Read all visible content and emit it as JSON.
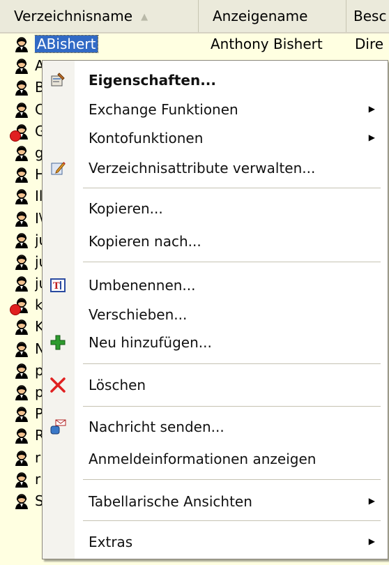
{
  "columns": {
    "name": "Verzeichnisname",
    "display": "Anzeigename",
    "third": "Besc"
  },
  "rows": [
    {
      "name": "ABishert",
      "display": "Anthony Bishert",
      "third": "Dire",
      "selected": true,
      "disabled": false
    },
    {
      "name": "A",
      "display": "",
      "third": "",
      "selected": false,
      "disabled": false
    },
    {
      "name": "B",
      "display": "",
      "third": "",
      "selected": false,
      "disabled": false
    },
    {
      "name": "C",
      "display": "",
      "third": "",
      "selected": false,
      "disabled": false
    },
    {
      "name": "G",
      "display": "",
      "third": "",
      "selected": false,
      "disabled": true
    },
    {
      "name": "g",
      "display": "",
      "third": "",
      "selected": false,
      "disabled": false
    },
    {
      "name": "H",
      "display": "",
      "third": "",
      "selected": false,
      "disabled": false
    },
    {
      "name": "Il",
      "display": "",
      "third": "",
      "selected": false,
      "disabled": false
    },
    {
      "name": "I\\",
      "display": "",
      "third": "",
      "selected": false,
      "disabled": false
    },
    {
      "name": "ju",
      "display": "",
      "third": "",
      "selected": false,
      "disabled": false
    },
    {
      "name": "ju",
      "display": "",
      "third": "",
      "selected": false,
      "disabled": false
    },
    {
      "name": "ju",
      "display": "",
      "third": "",
      "selected": false,
      "disabled": false
    },
    {
      "name": "k",
      "display": "",
      "third": "",
      "selected": false,
      "disabled": true
    },
    {
      "name": "K",
      "display": "",
      "third": "",
      "selected": false,
      "disabled": false
    },
    {
      "name": "N",
      "display": "",
      "third": "",
      "selected": false,
      "disabled": false
    },
    {
      "name": "p",
      "display": "",
      "third": "",
      "selected": false,
      "disabled": false
    },
    {
      "name": "p",
      "display": "",
      "third": "",
      "selected": false,
      "disabled": false
    },
    {
      "name": "P",
      "display": "",
      "third": "",
      "selected": false,
      "disabled": false
    },
    {
      "name": "R",
      "display": "",
      "third": "",
      "selected": false,
      "disabled": false
    },
    {
      "name": "ri",
      "display": "",
      "third": "",
      "selected": false,
      "disabled": false
    },
    {
      "name": "ri",
      "display": "",
      "third": "",
      "selected": false,
      "disabled": false
    },
    {
      "name": "S",
      "display": "",
      "third": "",
      "selected": false,
      "disabled": false
    }
  ],
  "menu": {
    "items": [
      {
        "label": "Eigenschaften...",
        "bold": true,
        "icon": "properties-icon",
        "submenu": false
      },
      {
        "label": "Exchange Funktionen",
        "bold": false,
        "icon": "",
        "submenu": true
      },
      {
        "label": "Kontofunktionen",
        "bold": false,
        "icon": "",
        "submenu": true
      },
      {
        "label": "Verzeichnisattribute verwalten...",
        "bold": false,
        "icon": "edit-attributes-icon",
        "submenu": false
      },
      {
        "label": "Kopieren...",
        "bold": false,
        "icon": "",
        "submenu": false
      },
      {
        "label": "Kopieren nach...",
        "bold": false,
        "icon": "",
        "submenu": false
      },
      {
        "label": "Umbenennen...",
        "bold": false,
        "icon": "rename-icon",
        "submenu": false
      },
      {
        "label": "Verschieben...",
        "bold": false,
        "icon": "",
        "submenu": false
      },
      {
        "label": "Neu hinzufügen...",
        "bold": false,
        "icon": "add-icon",
        "submenu": false
      },
      {
        "label": "Löschen",
        "bold": false,
        "icon": "delete-icon",
        "submenu": false
      },
      {
        "label": "Nachricht senden...",
        "bold": false,
        "icon": "send-message-icon",
        "submenu": false
      },
      {
        "label": "Anmeldeinformationen anzeigen",
        "bold": false,
        "icon": "",
        "submenu": false
      },
      {
        "label": "Tabellarische Ansichten",
        "bold": false,
        "icon": "",
        "submenu": true
      },
      {
        "label": "Extras",
        "bold": false,
        "icon": "",
        "submenu": true
      }
    ]
  },
  "colors": {
    "list_background": "#ffffe1",
    "selection": "#316ac5",
    "delete_red": "#e02020",
    "add_green": "#2e9b2e"
  }
}
